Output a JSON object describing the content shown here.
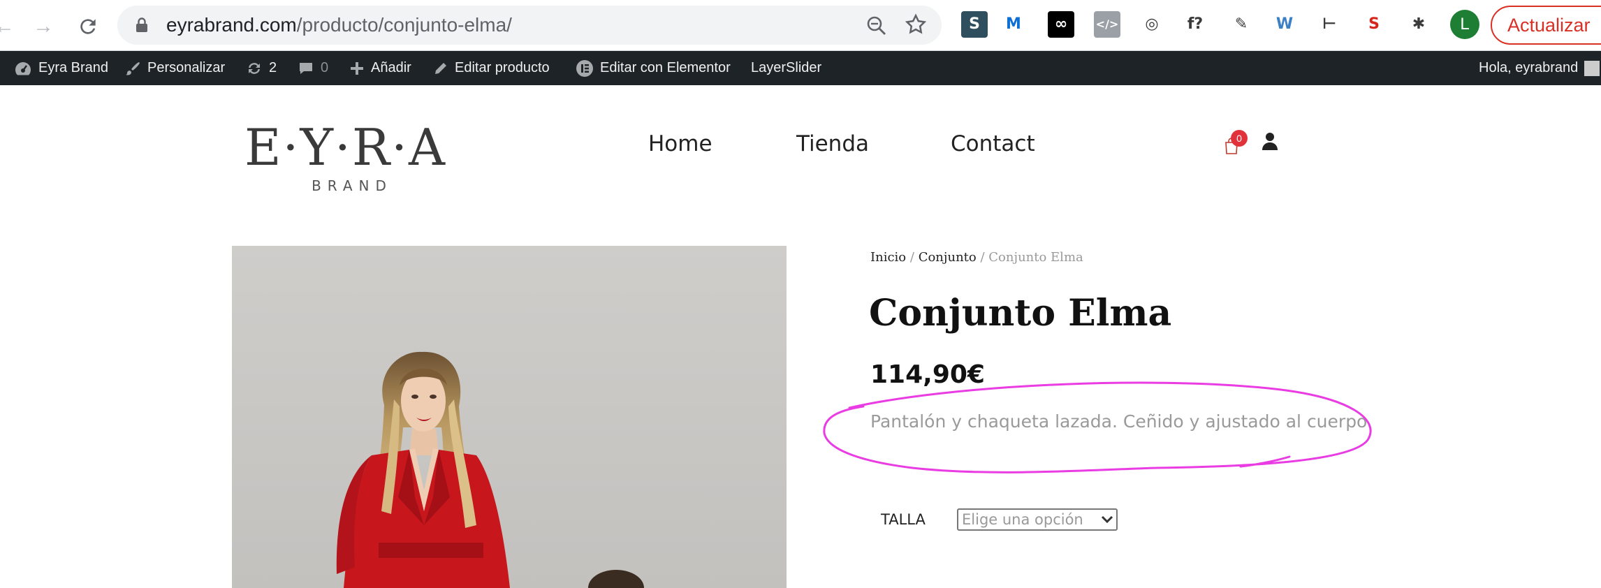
{
  "browser": {
    "url_domain": "eyrabrand.com",
    "url_path": "/producto/conjunto-elma/",
    "extensions": [
      {
        "icon": "seo-s-icon",
        "letter": "S",
        "bg": "#2f4f5f"
      },
      {
        "icon": "movistar-icon",
        "letter": "M",
        "bg": "#ffffff"
      },
      {
        "icon": "infinity-icon",
        "letter": "∞",
        "bg": "#000000"
      },
      {
        "icon": "code-icon",
        "letter": "</>",
        "bg": "#9aa0a6"
      },
      {
        "icon": "target-icon",
        "letter": "◎",
        "bg": "#ffffff"
      },
      {
        "icon": "font-question-icon",
        "letter": "f?",
        "bg": "#ffffff"
      },
      {
        "icon": "eyedropper-icon",
        "letter": "✎",
        "bg": "#ffffff"
      },
      {
        "icon": "wordpress-icon",
        "letter": "W",
        "bg": "#ffffff"
      },
      {
        "icon": "ruler-icon",
        "letter": "⊢",
        "bg": "#ffffff"
      },
      {
        "icon": "seo-quake-icon",
        "letter": "S",
        "bg": "#ffffff"
      },
      {
        "icon": "puzzle-icon",
        "letter": "✱",
        "bg": "#ffffff"
      }
    ],
    "profile_initial": "L",
    "update_label": "Actualizar"
  },
  "admin_bar": {
    "site_name": "Eyra Brand",
    "customize": "Personalizar",
    "updates_count": "2",
    "comments_count": "0",
    "add_new": "Añadir",
    "edit_product": "Editar producto",
    "edit_elementor": "Editar con Elementor",
    "layerslider": "LayerSlider",
    "greeting": "Hola, eyrabrand"
  },
  "header": {
    "logo_main": "E·Y·R·A",
    "logo_sub": "BRAND",
    "menu": [
      "Home",
      "Tienda",
      "Contact"
    ],
    "cart_count": "0"
  },
  "product": {
    "breadcrumb": {
      "home": "Inicio",
      "separator": "/",
      "category": "Conjunto",
      "current": "Conjunto Elma"
    },
    "title": "Conjunto Elma",
    "price": "114,90€",
    "short_description": "Pantalón y chaqueta lazada. Ceñido y ajustado al cuerpo.",
    "attribute_label": "TALLA",
    "select_placeholder": "Elige una opción"
  },
  "colors": {
    "admin_bar_bg": "#1d2327",
    "annotation": "#e93ce3",
    "cart_badge": "#e1323b",
    "jacket_red": "#c8161d"
  }
}
